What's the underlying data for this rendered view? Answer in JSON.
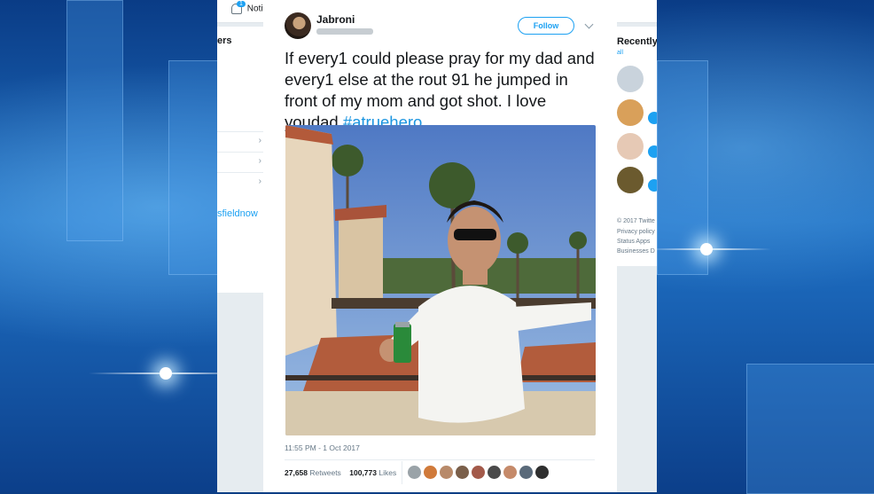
{
  "twitter_page": {
    "notifications": {
      "label": "Notifi",
      "count": "1"
    },
    "left_column": {
      "header_fragment": "ers",
      "link_fragment": "sfieldnow"
    },
    "right_column": {
      "header_fragment": "Recently",
      "view_all_fragment": "all",
      "footer_lines": [
        "© 2017 Twitte",
        "Privacy policy",
        "Status  Apps",
        "Businesses  D"
      ]
    }
  },
  "tweet": {
    "author_name": "Jabroni",
    "follow_label": "Follow",
    "text": "If every1 could please pray for my dad and every1 else at the rout 91 he jumped in front of my mom and got shot. I love youdad",
    "hashtag": "#atruehero",
    "timestamp": "11:55 PM - 1 Oct 2017",
    "retweets": {
      "count": "27,658",
      "label": "Retweets"
    },
    "likes": {
      "count": "100,773",
      "label": "Likes"
    }
  },
  "colors": {
    "accent": "#1da1f2",
    "hashtag": "#1b95e0",
    "text": "#14171a",
    "muted": "#657786"
  },
  "icons": [
    "bell-icon",
    "chevron-down-icon",
    "chevron-right-icon"
  ]
}
